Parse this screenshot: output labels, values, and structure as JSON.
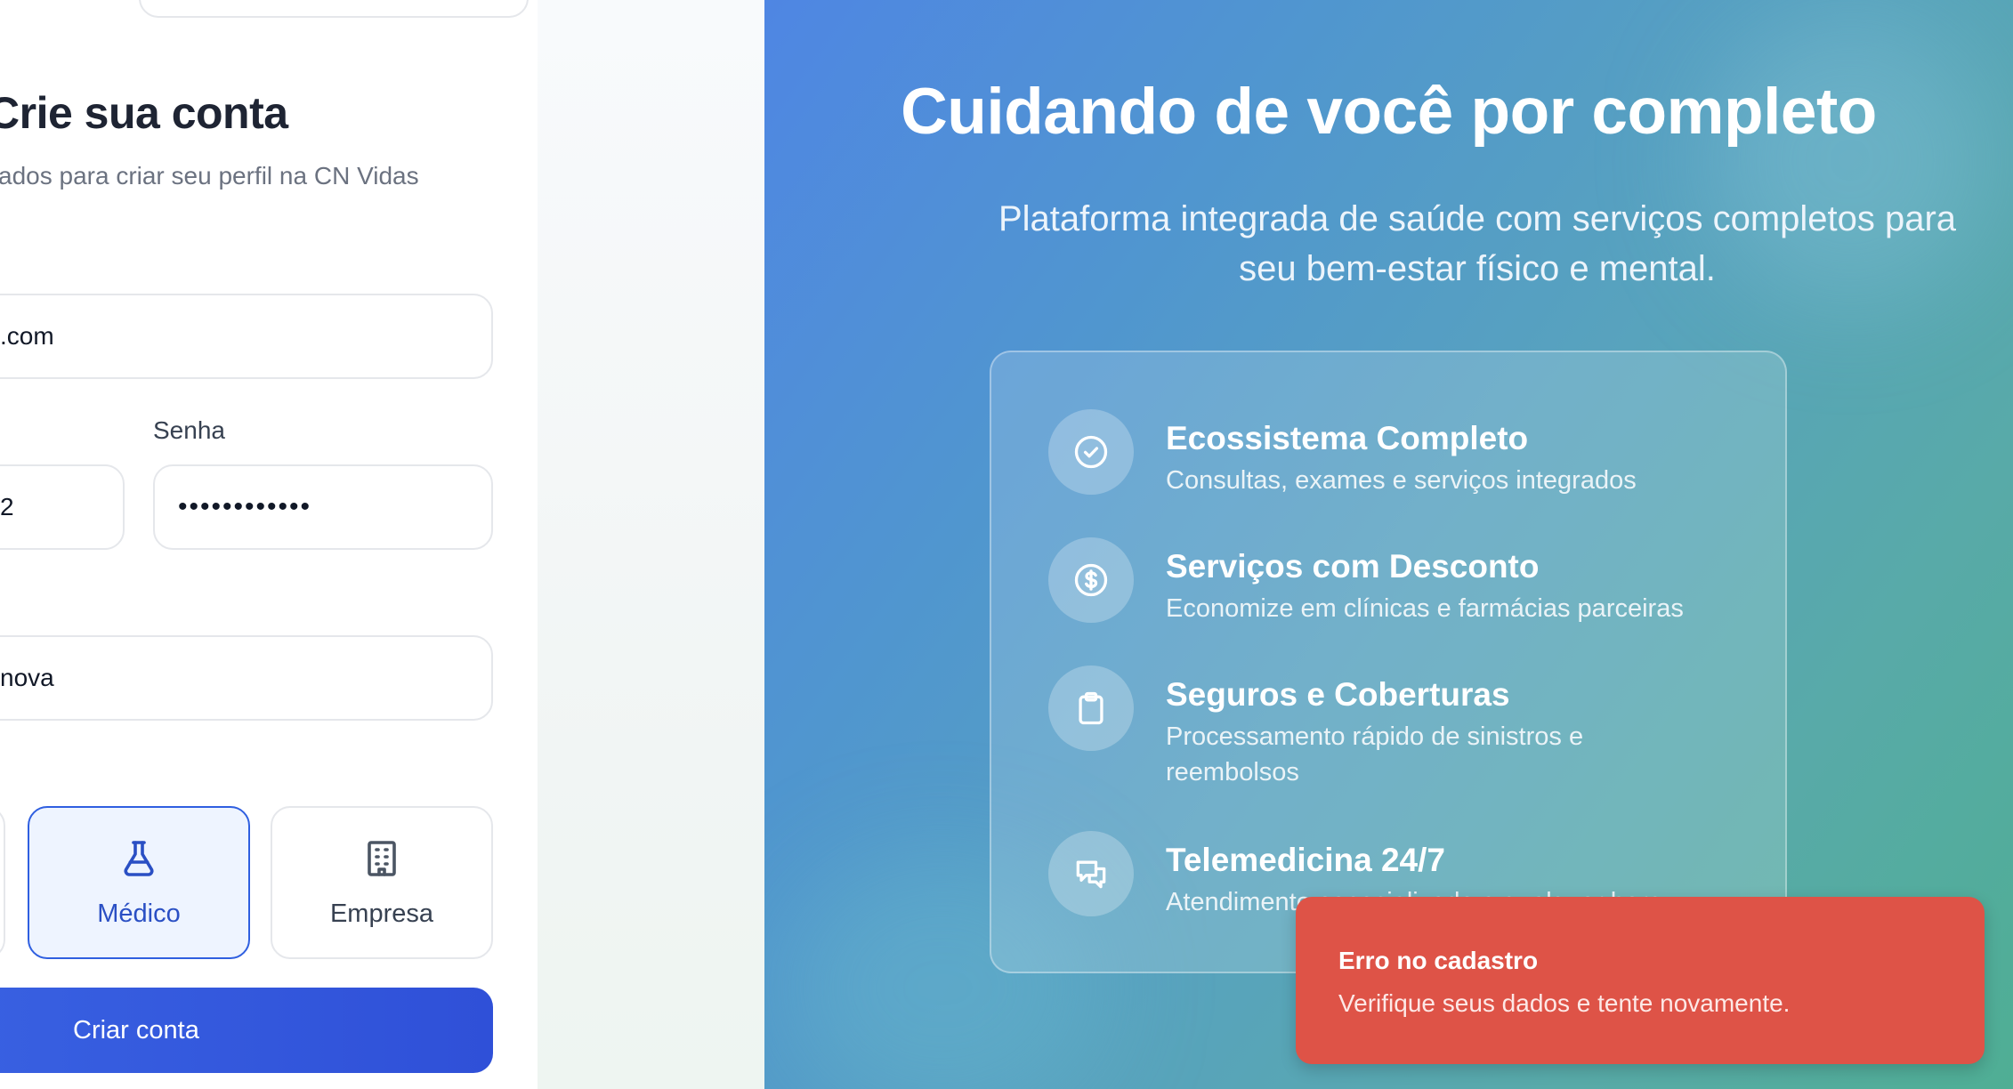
{
  "signup_form": {
    "title": "Crie sua conta",
    "subtitle": "ados para criar seu perfil na CN Vidas",
    "email_value": ".com",
    "phone_value": "2",
    "password_label": "Senha",
    "password_value": "••••••••••••",
    "name_value": "nova",
    "account_types": [
      {
        "label": "",
        "icon": "partial-card",
        "selected": false
      },
      {
        "label": "Médico",
        "icon": "flask-icon",
        "selected": true
      },
      {
        "label": "Empresa",
        "icon": "building-icon",
        "selected": false
      }
    ],
    "submit_label": "Criar conta"
  },
  "hero": {
    "title": "Cuidando de você por completo",
    "subtitle": "Plataforma integrada de saúde com serviços completos para seu bem-estar físico e mental."
  },
  "features": [
    {
      "icon": "check-circle-icon",
      "title": "Ecossistema Completo",
      "description": "Consultas, exames e serviços integrados"
    },
    {
      "icon": "dollar-circle-icon",
      "title": "Serviços com Desconto",
      "description": "Economize em clínicas e farmácias parceiras"
    },
    {
      "icon": "clipboard-icon",
      "title": "Seguros e Coberturas",
      "description": "Processamento rápido de sinistros e reembolsos"
    },
    {
      "icon": "chat-bubbles-icon",
      "title": "Telemedicina 24/7",
      "description": "Atendimento especializado a qualquer hora"
    }
  ],
  "toast": {
    "title": "Erro no cadastro",
    "message": "Verifique seus dados e tente novamente.",
    "color": "#de5347"
  },
  "colors": {
    "primary": "#2f50d8",
    "selected_border": "#2f5fe0",
    "gradient_start": "#4f86e3",
    "gradient_end": "#4fae94"
  }
}
